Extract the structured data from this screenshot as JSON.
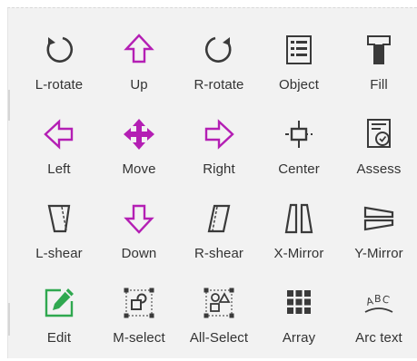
{
  "tools": [
    {
      "label": "L-rotate",
      "icon": "rotate-left-icon"
    },
    {
      "label": "Up",
      "icon": "arrow-up-icon"
    },
    {
      "label": "R-rotate",
      "icon": "rotate-right-icon"
    },
    {
      "label": "Object",
      "icon": "object-list-icon"
    },
    {
      "label": "Fill",
      "icon": "fill-icon"
    },
    {
      "label": "Left",
      "icon": "arrow-left-icon"
    },
    {
      "label": "Move",
      "icon": "move-icon"
    },
    {
      "label": "Right",
      "icon": "arrow-right-icon"
    },
    {
      "label": "Center",
      "icon": "center-icon"
    },
    {
      "label": "Assess",
      "icon": "assess-icon"
    },
    {
      "label": "L-shear",
      "icon": "left-shear-icon"
    },
    {
      "label": "Down",
      "icon": "arrow-down-icon"
    },
    {
      "label": "R-shear",
      "icon": "right-shear-icon"
    },
    {
      "label": "X-Mirror",
      "icon": "x-mirror-icon"
    },
    {
      "label": "Y-Mirror",
      "icon": "y-mirror-icon"
    },
    {
      "label": "Edit",
      "icon": "edit-icon"
    },
    {
      "label": "M-select",
      "icon": "multi-select-icon"
    },
    {
      "label": "All-Select",
      "icon": "all-select-icon"
    },
    {
      "label": "Array",
      "icon": "array-grid-icon"
    },
    {
      "label": "Arc text",
      "icon": "arc-text-icon"
    }
  ],
  "colors": {
    "panel_bg": "#f2f2f2",
    "icon_dark": "#3a3a3a",
    "accent_purple": "#b41fb4",
    "accent_green": "#2fa84f",
    "label_text": "#333333"
  }
}
